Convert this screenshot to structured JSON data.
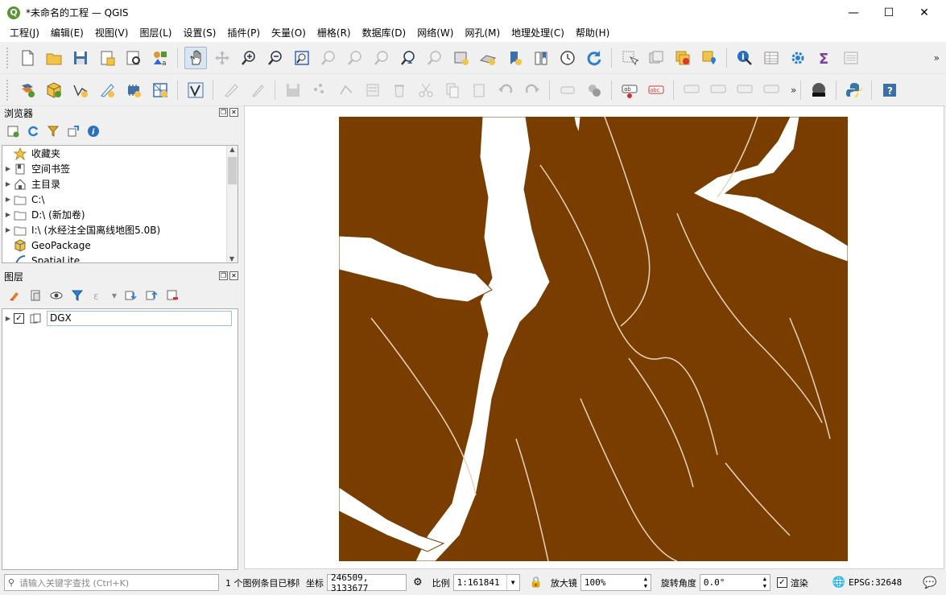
{
  "window": {
    "title": "*未命名的工程 — QGIS",
    "app_icon": "qgis-icon",
    "minimize": "—",
    "maximize": "☐",
    "close": "✕"
  },
  "menu": [
    "工程(J)",
    "编辑(E)",
    "视图(V)",
    "图层(L)",
    "设置(S)",
    "插件(P)",
    "矢量(O)",
    "栅格(R)",
    "数据库(D)",
    "网络(W)",
    "网孔(M)",
    "地理处理(C)",
    "帮助(H)"
  ],
  "toolbar_more": "»",
  "browser": {
    "title": "浏览器",
    "items": [
      {
        "label": "收藏夹",
        "icon": "star-icon",
        "expandable": false
      },
      {
        "label": "空间书签",
        "icon": "bookmark-icon",
        "expandable": true
      },
      {
        "label": "主目录",
        "icon": "home-icon",
        "expandable": true
      },
      {
        "label": "C:\\",
        "icon": "folder-icon",
        "expandable": true
      },
      {
        "label": "D:\\ (新加卷)",
        "icon": "folder-icon",
        "expandable": true
      },
      {
        "label": "I:\\ (水经注全国离线地图5.0B)",
        "icon": "folder-icon",
        "expandable": true
      },
      {
        "label": "GeoPackage",
        "icon": "geopackage-icon",
        "expandable": false
      },
      {
        "label": "SpatiaLite",
        "icon": "spatialite-icon",
        "expandable": false
      }
    ]
  },
  "layers": {
    "title": "图层",
    "items": [
      {
        "label": "DGX",
        "checked": true,
        "icon": "line-layer-icon"
      }
    ]
  },
  "map": {
    "layer_color": "#7a3d00"
  },
  "status": {
    "search_placeholder": "请输入关键字查找 (Ctrl+K)",
    "message": "1 个图例条目已移除",
    "coord_label": "坐标",
    "coord_value": "246509, 3133677",
    "scale_label": "比例",
    "scale_value": "1:161841",
    "magnifier_label": "放大镜",
    "magnifier_value": "100%",
    "rotation_label": "旋转角度",
    "rotation_value": "0.0°",
    "render_label": "渲染",
    "render_checked": "✓",
    "crs": "EPSG:32648"
  }
}
